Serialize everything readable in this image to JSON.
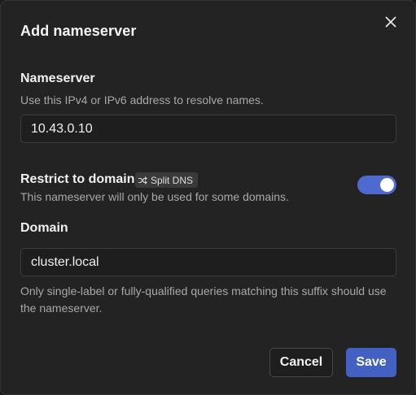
{
  "dialog": {
    "title": "Add nameserver",
    "close_icon": "close-icon"
  },
  "nameserver": {
    "label": "Nameserver",
    "help": "Use this IPv4 or IPv6 address to resolve names.",
    "value": "10.43.0.10"
  },
  "restrict": {
    "label": "Restrict to domain",
    "badge_icon": "shuffle-icon",
    "badge_label": "Split DNS",
    "help": "This nameserver will only be used for some domains.",
    "enabled": true,
    "toggle_color": "#4e6ad0"
  },
  "domain": {
    "label": "Domain",
    "value": "cluster.local",
    "help": "Only single-label or fully-qualified queries matching this suffix should use the nameserver."
  },
  "actions": {
    "cancel_label": "Cancel",
    "save_label": "Save",
    "save_color": "#4361c2"
  }
}
